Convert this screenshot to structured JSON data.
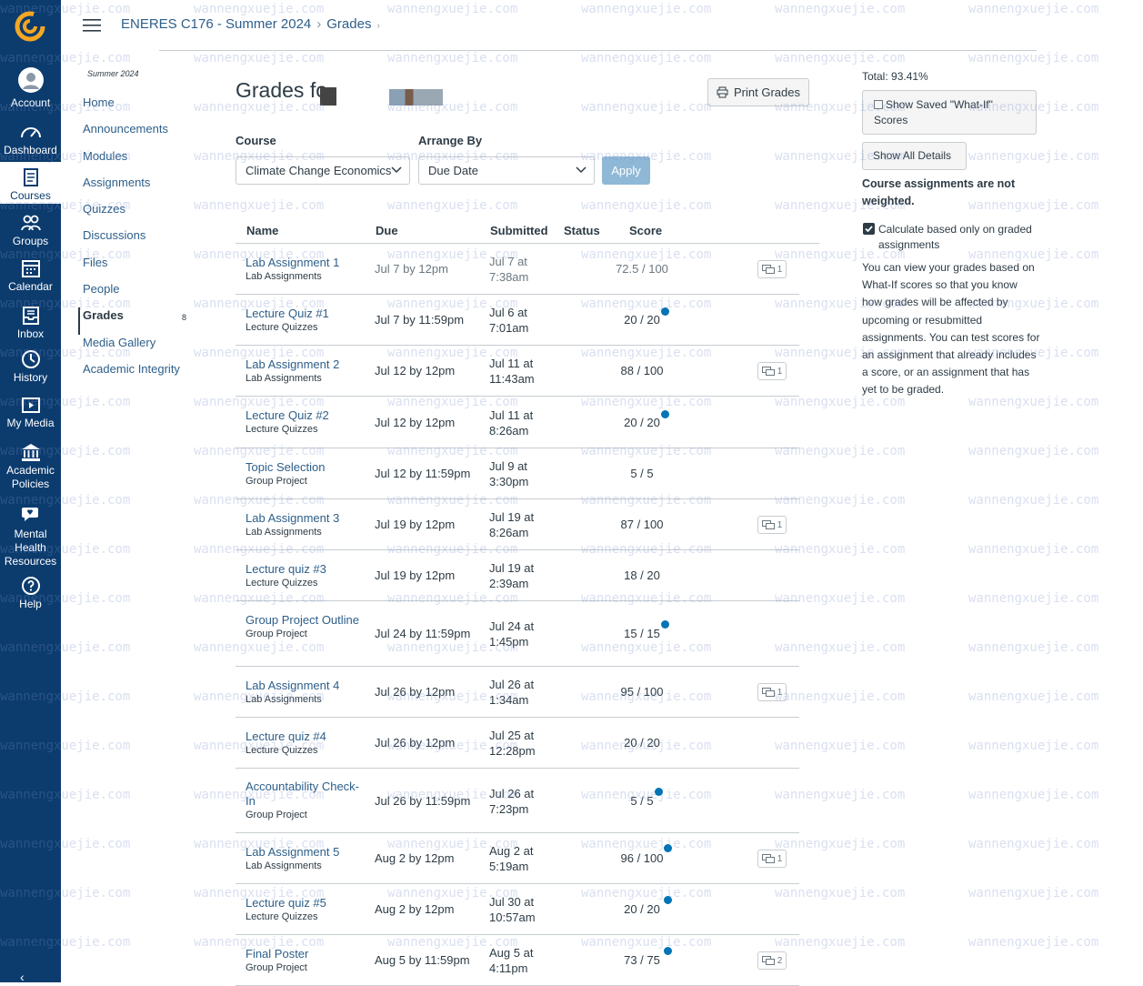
{
  "global_nav": {
    "items": [
      {
        "label": "Account",
        "icon": "account-icon"
      },
      {
        "label": "Dashboard",
        "icon": "dashboard-icon"
      },
      {
        "label": "Courses",
        "icon": "courses-icon",
        "active": true
      },
      {
        "label": "Groups",
        "icon": "groups-icon"
      },
      {
        "label": "Calendar",
        "icon": "calendar-icon"
      },
      {
        "label": "Inbox",
        "icon": "inbox-icon"
      },
      {
        "label": "History",
        "icon": "history-icon"
      },
      {
        "label": "My Media",
        "icon": "my-media-icon"
      },
      {
        "label": "Academic Policies",
        "icon": "academic-policies-icon"
      },
      {
        "label": "Mental Health Resources",
        "icon": "mental-health-icon"
      },
      {
        "label": "Help",
        "icon": "help-icon"
      }
    ]
  },
  "breadcrumb": {
    "course": "ENERES C176 - Summer 2024",
    "page": "Grades"
  },
  "course_nav": {
    "term": "Summer 2024",
    "items": [
      {
        "label": "Home"
      },
      {
        "label": "Announcements"
      },
      {
        "label": "Modules"
      },
      {
        "label": "Assignments"
      },
      {
        "label": "Quizzes"
      },
      {
        "label": "Discussions"
      },
      {
        "label": "Files"
      },
      {
        "label": "People"
      },
      {
        "label": "Grades",
        "active": true,
        "badge": "8"
      },
      {
        "label": "Media Gallery"
      },
      {
        "label": "Academic Integrity"
      }
    ]
  },
  "header": {
    "title": "Grades fo",
    "print_label": "Print Grades",
    "course_label": "Course",
    "course_value": "Climate Change Economics",
    "arrange_label": "Arrange By",
    "arrange_value": "Due Date",
    "apply_label": "Apply"
  },
  "table": {
    "columns": [
      "Name",
      "Due",
      "Submitted",
      "Status",
      "Score"
    ],
    "rows": [
      {
        "name": "Lab Assignment 1",
        "category": "Lab Assignments",
        "due": "Jul 7 by 12pm",
        "submitted": "Jul 7 at 7:38am",
        "score": "72.5 / 100",
        "comments": "1",
        "muted": true
      },
      {
        "name": "Lecture Quiz #1",
        "category": "Lecture Quizzes",
        "due": "Jul 7 by 11:59pm",
        "submitted": "Jul 6 at 7:01am",
        "score": "20 / 20",
        "dot": true
      },
      {
        "name": "Lab Assignment 2",
        "category": "Lab Assignments",
        "due": "Jul 12 by 12pm",
        "submitted": "Jul 11 at 11:43am",
        "score": "88 / 100",
        "comments": "1"
      },
      {
        "name": "Lecture Quiz #2",
        "category": "Lecture Quizzes",
        "due": "Jul 12 by 12pm",
        "submitted": "Jul 11 at 8:26am",
        "score": "20 / 20",
        "dot": true
      },
      {
        "name": "Topic Selection",
        "category": "Group Project",
        "due": "Jul 12 by 11:59pm",
        "submitted": "Jul 9 at 3:30pm",
        "score": "5 / 5"
      },
      {
        "name": "Lab Assignment 3",
        "category": "Lab Assignments",
        "due": "Jul 19 by 12pm",
        "submitted": "Jul 19 at 8:26am",
        "score": "87 / 100",
        "comments": "1"
      },
      {
        "name": "Lecture quiz #3",
        "category": "Lecture Quizzes",
        "due": "Jul 19 by 12pm",
        "submitted": "Jul 19 at 2:39am",
        "score": "18 / 20"
      },
      {
        "name": "Group Project Outline",
        "category": "Group Project",
        "due": "Jul 24 by 11:59pm",
        "submitted": "Jul 24 at 1:45pm",
        "score": "15 / 15",
        "dot": true
      },
      {
        "name": "Lab Assignment 4",
        "category": "Lab Assignments",
        "due": "Jul 26 by 12pm",
        "submitted": "Jul 26 at 1:34am",
        "score": "95 / 100",
        "comments": "1"
      },
      {
        "name": "Lecture quiz #4",
        "category": "Lecture Quizzes",
        "due": "Jul 26 by 12pm",
        "submitted": "Jul 25 at 12:28pm",
        "score": "20 / 20"
      },
      {
        "name": "Accountability Check-In",
        "category": "Group Project",
        "due": "Jul 26 by 11:59pm",
        "submitted": "Jul 26 at 7:23pm",
        "score": "5 / 5",
        "dot": true
      },
      {
        "name": "Lab Assignment 5",
        "category": "Lab Assignments",
        "due": "Aug 2 by 12pm",
        "submitted": "Aug 2 at 5:19am",
        "score": "96 / 100",
        "dot": true,
        "comments": "1"
      },
      {
        "name": "Lecture quiz #5",
        "category": "Lecture Quizzes",
        "due": "Aug 2 by 12pm",
        "submitted": "Jul 30 at 10:57am",
        "score": "20 / 20",
        "dot": true
      },
      {
        "name": "Final Poster",
        "category": "Group Project",
        "due": "Aug 5 by 11:59pm",
        "submitted": "Aug 5 at 4:11pm",
        "score": "73 / 75",
        "dot": true,
        "comments": "2"
      }
    ]
  },
  "sidebar": {
    "total": "Total: 93.41%",
    "show_saved_label": "Show Saved \"What-If\" Scores",
    "show_all_label": "Show All Details",
    "weight_note": "Course assignments are not weighted.",
    "calc_label": "Calculate based only on graded assignments",
    "calc_checked": true,
    "info": "You can view your grades based on What-If scores so that you know how grades will be affected by upcoming or resubmitted assignments. You can test scores for an assignment that already includes a score, or an assignment that has yet to be graded."
  },
  "watermark": "wannengxuejie.com",
  "colors": {
    "nav_bg": "#0c3c6e",
    "link": "#2d5f8a",
    "accent": "#0374b5",
    "logo": "#f5a623"
  }
}
